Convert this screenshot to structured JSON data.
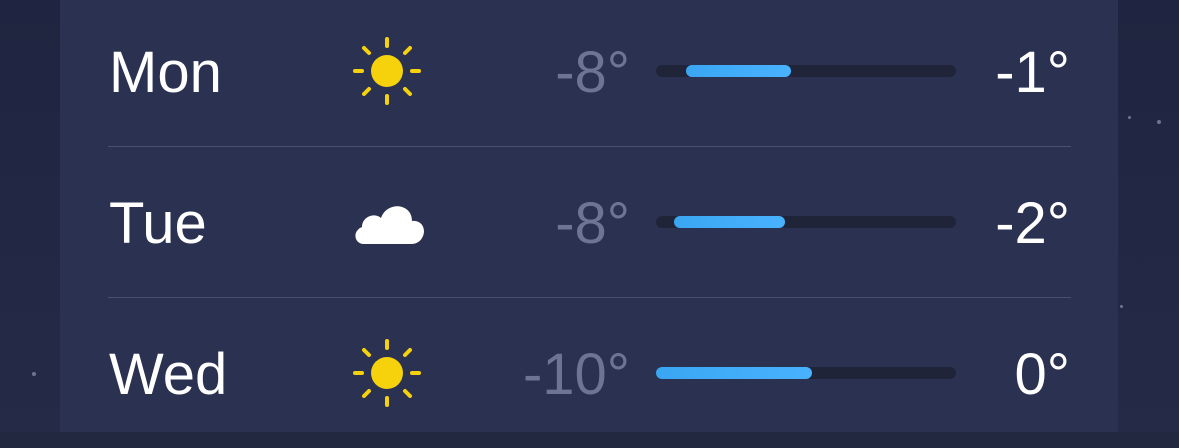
{
  "forecast": [
    {
      "day": "Mon",
      "icon": "sun-icon",
      "low": "-8°",
      "high": "-1°",
      "range_start": 0.1,
      "range_end": 0.45
    },
    {
      "day": "Tue",
      "icon": "cloud-icon",
      "low": "-8°",
      "high": "-2°",
      "range_start": 0.06,
      "range_end": 0.43
    },
    {
      "day": "Wed",
      "icon": "sun-icon",
      "low": "-10°",
      "high": "0°",
      "range_start": 0.0,
      "range_end": 0.52
    }
  ],
  "colors": {
    "background": "#222840",
    "card": "#2b3150",
    "temperature_bar": "#3aa6f2",
    "sun": "#f6d20c",
    "low_text": "#6e7593",
    "high_text": "#ffffff"
  }
}
